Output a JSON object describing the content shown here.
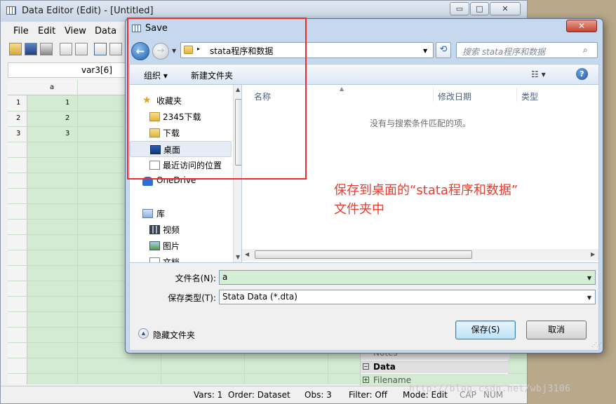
{
  "editor": {
    "title": "Data Editor (Edit) - [Untitled]",
    "window_controls": [
      "▭",
      "□",
      "✕"
    ],
    "menu": [
      "File",
      "Edit",
      "View",
      "Data"
    ],
    "cell_ref": "var3[6]",
    "column_header": "a",
    "rows": [
      {
        "num": "1",
        "a": "1"
      },
      {
        "num": "2",
        "a": "2"
      },
      {
        "num": "3",
        "a": "3"
      }
    ],
    "properties": {
      "notes_label": "Notes",
      "data_label": "Data",
      "filename_label": "Filename"
    },
    "status": {
      "vars": "Vars: 1",
      "order": "Order: Dataset",
      "obs": "Obs: 3",
      "filter": "Filter: Off",
      "mode": "Mode: Edit",
      "cap": "CAP",
      "num": "NUM"
    },
    "watermark": "http://blog.csdn.net/wbj3106"
  },
  "dialog": {
    "title": "Save",
    "close_glyph": "✕",
    "back_glyph": "←",
    "forward_glyph": "→",
    "address": {
      "separator": "▸",
      "folder": "stata程序和数据",
      "dropdown_glyph": "▼"
    },
    "refresh_glyph": "⟲",
    "search": {
      "placeholder": "搜索 stata程序和数据",
      "icon_glyph": "⌕"
    },
    "commands": {
      "organize": "组织 ▾",
      "new_folder": "新建文件夹",
      "view_glyph": "☷ ▾",
      "help_glyph": "?"
    },
    "nav": {
      "favorites": "收藏夹",
      "items": [
        "2345下载",
        "下载",
        "桌面",
        "最近访问的位置"
      ],
      "onedrive": "OneDrive",
      "library": "库",
      "library_items": [
        "视频",
        "图片",
        "文档"
      ],
      "star_glyph": "★"
    },
    "columns": [
      "名称",
      "修改日期",
      "类型"
    ],
    "empty_message": "没有与搜索条件匹配的项。",
    "filename_label": "文件名(N):",
    "filename_value": "a",
    "filetype_label": "保存类型(T):",
    "filetype_value": "Stata Data (*.dta)",
    "hide_folders": "隐藏文件夹",
    "save_button": "保存(S)",
    "cancel_button": "取消"
  },
  "annotation": {
    "line1": "保存到桌面的“stata程序和数据”",
    "line2": "文件夹中",
    "color": "#ef3b2d"
  }
}
